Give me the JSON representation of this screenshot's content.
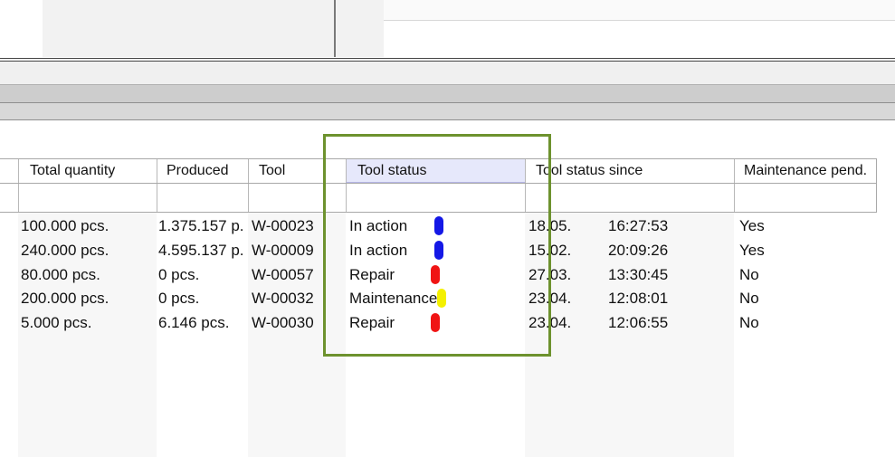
{
  "grid": {
    "columns": [
      {
        "key": "total",
        "label": "Total quantity"
      },
      {
        "key": "produced",
        "label": "Produced"
      },
      {
        "key": "tool",
        "label": "Tool"
      },
      {
        "key": "status",
        "label": "Tool status"
      },
      {
        "key": "since",
        "label": "Tool status since"
      },
      {
        "key": "maint",
        "label": "Maintenance pend."
      }
    ],
    "rows": [
      {
        "total": "100.000 pcs.",
        "produced": "1.375.157 p.",
        "tool": "W-00023",
        "status": "In action",
        "status_color": "#1418e6",
        "date": "18.05.",
        "time": "16:27:53",
        "maint": "Yes"
      },
      {
        "total": "240.000 pcs.",
        "produced": "4.595.137 p.",
        "tool": "W-00009",
        "status": "In action",
        "status_color": "#1418e6",
        "date": "15.02.",
        "time": "20:09:26",
        "maint": "Yes"
      },
      {
        "total": "80.000 pcs.",
        "produced": "0 pcs.",
        "tool": "W-00057",
        "status": "Repair",
        "status_color": "#f01414",
        "date": "27.03.",
        "time": "13:30:45",
        "maint": "No"
      },
      {
        "total": "200.000 pcs.",
        "produced": "0 pcs.",
        "tool": "W-00032",
        "status": "Maintenance",
        "status_color": "#f4f000",
        "date": "23.04.",
        "time": "12:08:01",
        "maint": "No"
      },
      {
        "total": "5.000 pcs.",
        "produced": "6.146 pcs.",
        "tool": "W-00030",
        "status": "Repair",
        "status_color": "#f01414",
        "date": "23.04.",
        "time": "12:06:55",
        "maint": "No"
      }
    ]
  },
  "colors": {
    "highlight_box": "#6d922e",
    "active_header": "#e6e8fb",
    "in_action": "#1418e6",
    "repair": "#f01414",
    "maintenance": "#f4f000"
  }
}
